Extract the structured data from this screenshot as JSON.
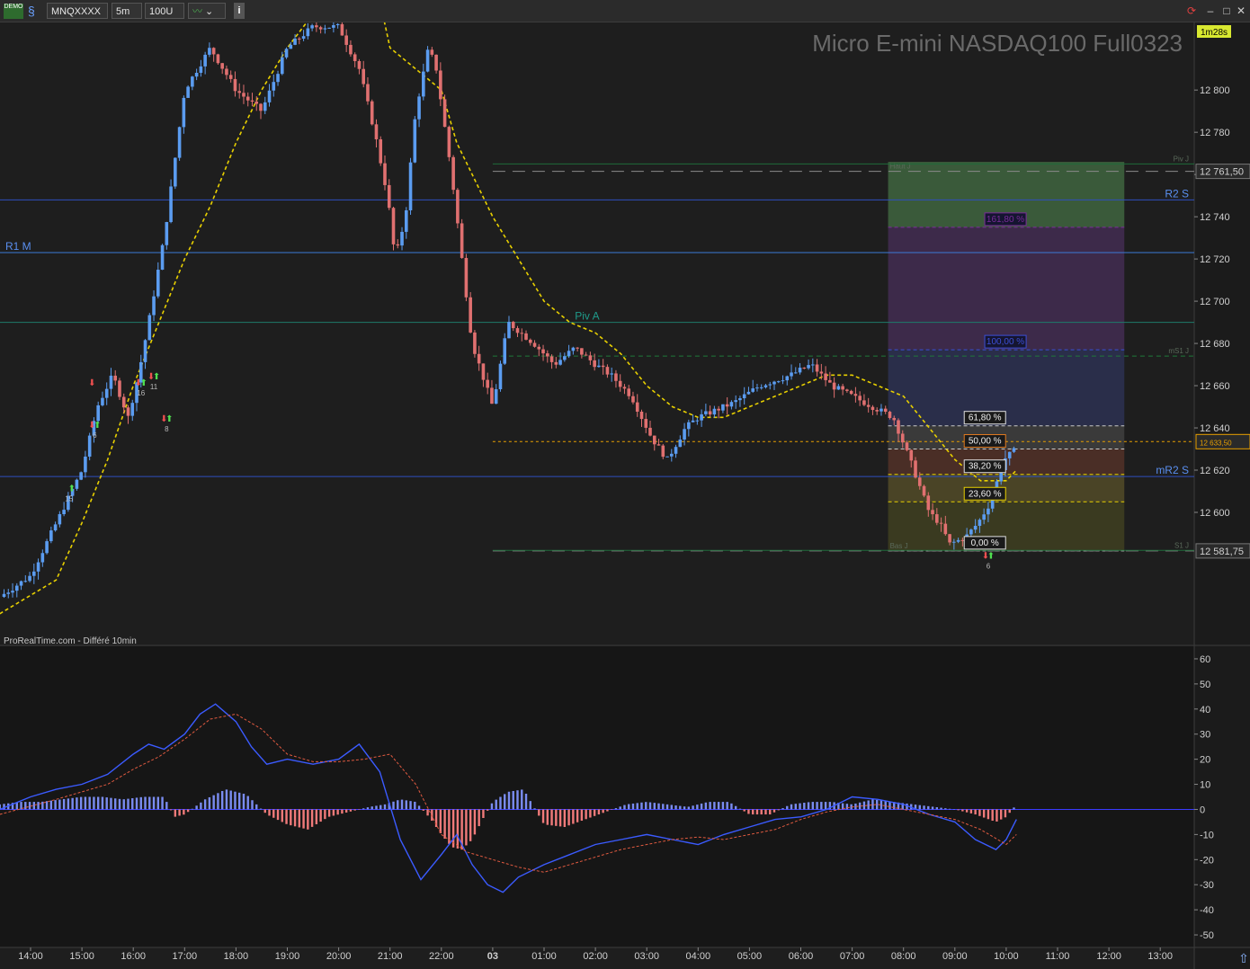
{
  "toolbar": {
    "demo_label": "DEMO",
    "instrument": "MNQXXXX",
    "timeframe": "5m",
    "units": "100U",
    "info_icon": "info-icon",
    "chevron_icon": "chevron-down-icon"
  },
  "chart_data": [
    {
      "type": "candlestick",
      "title": "Micro E-mini NASDAQ100 Full0323",
      "footer": "ProRealTime.com - Différé 10min",
      "timer": "1m28s",
      "ylim": [
        12537,
        12832
      ],
      "y_ticks": [
        12600,
        12620,
        12640,
        12660,
        12680,
        12700,
        12720,
        12740,
        12760,
        12780,
        12800
      ],
      "y_tick_labels": [
        "12 600",
        "12 620",
        "12 640",
        "12 660",
        "12 680",
        "12 700",
        "12 720",
        "12 740",
        "12 760",
        "12 780",
        "12 800"
      ],
      "x_ticks": [
        "14:00",
        "15:00",
        "16:00",
        "17:00",
        "18:00",
        "19:00",
        "20:00",
        "21:00",
        "22:00",
        "03",
        "01:00",
        "02:00",
        "03:00",
        "04:00",
        "05:00",
        "06:00",
        "07:00",
        "08:00",
        "09:00",
        "10:00",
        "11:00",
        "12:00",
        "13:00"
      ],
      "x_tick_hours": [
        0,
        1,
        2,
        3,
        4,
        5,
        6,
        7,
        8,
        9,
        10,
        11,
        12,
        13,
        14,
        15,
        16,
        17,
        18,
        19,
        20,
        21,
        22
      ],
      "price_path_hours": [
        -0.6,
        0.0,
        0.5,
        1.0,
        1.3,
        1.6,
        1.9,
        2.1,
        2.3,
        2.6,
        3.0,
        3.5,
        4.0,
        4.5,
        5.0,
        5.5,
        6.0,
        6.4,
        6.7,
        6.95,
        7.1,
        7.3,
        7.5,
        7.75,
        7.9,
        8.2,
        8.4,
        8.6,
        9.0,
        9.3,
        9.8,
        10.2,
        10.6,
        11.0,
        11.3,
        11.7,
        12.1,
        12.4,
        12.75,
        13.0,
        13.3,
        13.7,
        14.2,
        14.8,
        15.2,
        15.6,
        16.0,
        16.4,
        16.8,
        17.2,
        17.5,
        17.7,
        17.9,
        18.2,
        18.45,
        18.7,
        18.95,
        19.2
      ],
      "price_path_values": [
        12560,
        12570,
        12595,
        12620,
        12650,
        12665,
        12645,
        12665,
        12690,
        12730,
        12800,
        12820,
        12800,
        12790,
        12820,
        12830,
        12830,
        12810,
        12780,
        12750,
        12720,
        12740,
        12790,
        12820,
        12810,
        12760,
        12720,
        12680,
        12650,
        12690,
        12680,
        12670,
        12678,
        12670,
        12665,
        12655,
        12635,
        12625,
        12640,
        12645,
        12648,
        12652,
        12660,
        12665,
        12670,
        12660,
        12655,
        12650,
        12645,
        12620,
        12600,
        12595,
        12585,
        12588,
        12595,
        12605,
        12625,
        12630
      ],
      "moving_average_hours": [
        -0.6,
        0.5,
        1.0,
        1.5,
        2.0,
        2.5,
        3.0,
        3.5,
        4.0,
        4.5,
        5.0,
        5.5,
        6.0,
        6.3,
        6.6,
        7.0,
        7.5,
        8.0,
        8.3,
        8.6,
        9.0,
        9.5,
        10.0,
        10.5,
        11.0,
        11.5,
        12.0,
        12.5,
        13.0,
        13.5,
        14.0,
        14.5,
        15.0,
        15.5,
        16.0,
        16.5,
        17.0,
        17.5,
        18.0,
        18.5,
        19.0,
        19.2
      ],
      "moving_average_values": [
        12552,
        12568,
        12595,
        12625,
        12660,
        12690,
        12720,
        12745,
        12775,
        12800,
        12820,
        12836,
        12850,
        12860,
        12865,
        12820,
        12810,
        12800,
        12775,
        12760,
        12740,
        12720,
        12700,
        12690,
        12685,
        12675,
        12660,
        12650,
        12645,
        12645,
        12650,
        12655,
        12660,
        12665,
        12665,
        12660,
        12655,
        12640,
        12625,
        12615,
        12615,
        12620
      ],
      "horizontal_levels": [
        {
          "label": "Haut J",
          "value": 12761.5,
          "color": "#8a8a8a",
          "style": "long-dash",
          "start_hour": 9
        },
        {
          "label": "Piv J",
          "value": 12765,
          "color": "#1f6b3a",
          "style": "solid",
          "start_hour": 9
        },
        {
          "label": "R2 S",
          "value": 12748,
          "color": "#2f4fbf",
          "style": "solid"
        },
        {
          "label": "R1 M",
          "value": 12723,
          "color": "#3b7bd6",
          "style": "solid"
        },
        {
          "label": "Piv A",
          "value": 12690,
          "color": "#1f7a6a",
          "style": "solid"
        },
        {
          "label": "mS1 J",
          "value": 12674,
          "color": "#1f7a3a",
          "style": "dash",
          "start_hour": 9
        },
        {
          "label": "",
          "value": 12633.5,
          "color": "#e8a000",
          "style": "short-dash",
          "start_hour": 9
        },
        {
          "label": "mR2 S",
          "value": 12617,
          "color": "#2f4fbf",
          "style": "solid"
        },
        {
          "label": "Bas J",
          "value": 12581.75,
          "color": "#8a8a8a",
          "style": "long-dash",
          "start_hour": 9
        },
        {
          "label": "S1 J",
          "value": 12582,
          "color": "#1f6b3a",
          "style": "solid",
          "start_hour": 9
        }
      ],
      "price_badges": [
        {
          "label": "12 761,50",
          "value": 12761.5,
          "bg": "#2a2a2a",
          "fg": "#d0d0d0",
          "border": "#777"
        },
        {
          "label": "12 633,50",
          "value": 12633.5,
          "bg": "#2a2a2a",
          "fg": "#e8a000",
          "border": "#e8a000",
          "small": true
        },
        {
          "label": "12 581,75",
          "value": 12581.75,
          "bg": "#2a2a2a",
          "fg": "#d0d0d0",
          "border": "#777"
        }
      ],
      "fibonacci": {
        "start_hour": 16.7,
        "end_hour": 21.3,
        "zones": [
          {
            "from": 12766,
            "to": 12735,
            "color": "#3a5a3a"
          },
          {
            "from": 12735,
            "to": 12677,
            "color": "#3d2a4a"
          },
          {
            "from": 12677,
            "to": 12641,
            "color": "#2a2e4a"
          },
          {
            "from": 12641,
            "to": 12630,
            "color": "#3a3a3a"
          },
          {
            "from": 12630,
            "to": 12618,
            "color": "#4a2e26"
          },
          {
            "from": 12618,
            "to": 12605,
            "color": "#4a4426"
          },
          {
            "from": 12605,
            "to": 12581.75,
            "color": "#3a3a20"
          }
        ],
        "levels": [
          {
            "label": "161,80 %",
            "value": 12735,
            "box_color": "#7a2a9a",
            "line_color": "#7a2a9a",
            "label_hour": 18.6
          },
          {
            "label": "100,00 %",
            "value": 12677,
            "box_color": "#3b4fd6",
            "line_color": "#3b4fd6",
            "label_hour": 18.6
          },
          {
            "label": "61,80 %",
            "value": 12641,
            "box_color": "#e0e0e0",
            "line_color": "#c8c8c8",
            "label_hour": 18.2
          },
          {
            "label": "50,00 %",
            "value": 12630,
            "box_color": "#e07a20",
            "line_color": "#c8c8c8",
            "label_hour": 18.2
          },
          {
            "label": "38,20 %",
            "value": 12618,
            "box_color": "#e0e0e0",
            "line_color": "#e8d000",
            "label_hour": 18.2
          },
          {
            "label": "23,60 %",
            "value": 12605,
            "box_color": "#e8d000",
            "line_color": "#e8d000",
            "label_hour": 18.2
          },
          {
            "label": "0,00 %",
            "value": 12581.75,
            "box_color": "#e0e0e0",
            "line_color": "#c8c8c8",
            "label_hour": 18.2
          }
        ]
      },
      "signal_arrows": [
        {
          "hour": 0.75,
          "value": 12610,
          "dir": "up",
          "count": "15"
        },
        {
          "hour": 1.25,
          "value": 12660,
          "dir": "down",
          "count": ""
        },
        {
          "hour": 1.25,
          "value": 12640,
          "dir": "both",
          "count": "6"
        },
        {
          "hour": 2.15,
          "value": 12660,
          "dir": "both",
          "count": "16"
        },
        {
          "hour": 2.4,
          "value": 12663,
          "dir": "both",
          "count": "11"
        },
        {
          "hour": 2.65,
          "value": 12643,
          "dir": "both",
          "count": "8"
        },
        {
          "hour": 18.65,
          "value": 12578,
          "dir": "both",
          "count": "6"
        }
      ],
      "colors": {
        "up_candle": "#5b9cf0",
        "down_candle": "#e07070",
        "moving_average": "#e8d000",
        "background": "#1e1e1e",
        "title": "#6a6a6a"
      }
    },
    {
      "type": "macd",
      "ylim": [
        -55,
        65
      ],
      "y_ticks": [
        60,
        50,
        40,
        30,
        20,
        10,
        0,
        -10,
        -20,
        -30,
        -40,
        -50
      ],
      "y_tick_labels": [
        "60",
        "50",
        "40",
        "30",
        "20",
        "10",
        "0",
        "-10",
        "-20",
        "-30",
        "-40",
        "-50"
      ],
      "macd_hours": [
        -0.6,
        0.0,
        0.5,
        1.0,
        1.5,
        2.0,
        2.3,
        2.6,
        3.0,
        3.3,
        3.6,
        4.0,
        4.3,
        4.6,
        5.0,
        5.5,
        6.0,
        6.4,
        6.8,
        7.2,
        7.6,
        8.0,
        8.3,
        8.6,
        8.9,
        9.2,
        9.5,
        10.0,
        10.5,
        11.0,
        11.5,
        12.0,
        12.5,
        13.0,
        13.5,
        14.0,
        14.5,
        15.0,
        15.5,
        16.0,
        16.5,
        17.0,
        17.5,
        18.0,
        18.4,
        18.8,
        19.0,
        19.2
      ],
      "macd_values": [
        0,
        5,
        8,
        10,
        14,
        22,
        26,
        24,
        30,
        38,
        42,
        35,
        25,
        18,
        20,
        18,
        20,
        26,
        15,
        -12,
        -28,
        -18,
        -10,
        -22,
        -30,
        -33,
        -27,
        -22,
        -18,
        -14,
        -12,
        -10,
        -12,
        -14,
        -10,
        -7,
        -4,
        -3,
        0,
        5,
        4,
        2,
        -2,
        -5,
        -12,
        -16,
        -12,
        -4
      ],
      "signal_hours": [
        -0.6,
        0.5,
        1.0,
        1.5,
        2.0,
        2.5,
        3.0,
        3.5,
        4.0,
        4.5,
        5.0,
        5.5,
        6.0,
        6.5,
        7.0,
        7.5,
        8.0,
        8.5,
        9.0,
        9.5,
        10.0,
        10.5,
        11.0,
        11.5,
        12.0,
        12.5,
        13.0,
        13.5,
        14.0,
        14.5,
        15.0,
        15.5,
        16.0,
        16.5,
        17.0,
        17.5,
        18.0,
        18.5,
        19.0,
        19.2
      ],
      "signal_values": [
        -2,
        4,
        7,
        10,
        16,
        21,
        28,
        36,
        38,
        32,
        22,
        19,
        19,
        20,
        22,
        10,
        -10,
        -17,
        -20,
        -23,
        -25,
        -22,
        -19,
        -16,
        -14,
        -12,
        -11,
        -12,
        -10,
        -8,
        -4,
        -1,
        1,
        2,
        0,
        -2,
        -4,
        -8,
        -14,
        -10
      ],
      "histogram_hours": [
        -0.6,
        -0.2,
        0.2,
        0.6,
        1.0,
        1.4,
        1.8,
        2.2,
        2.6,
        2.8,
        3.0,
        3.4,
        3.8,
        4.2,
        4.6,
        5.0,
        5.4,
        5.8,
        6.2,
        6.6,
        6.9,
        7.2,
        7.5,
        7.8,
        8.0,
        8.2,
        8.4,
        8.6,
        8.8,
        9.0,
        9.3,
        9.6,
        10.0,
        10.4,
        10.8,
        11.2,
        11.6,
        12.0,
        12.4,
        12.8,
        13.2,
        13.6,
        14.0,
        14.4,
        14.8,
        15.2,
        15.6,
        16.0,
        16.4,
        16.8,
        17.2,
        17.6,
        18.0,
        18.4,
        18.8,
        19.0,
        19.2
      ],
      "histogram_values": [
        2,
        3,
        3,
        4,
        5,
        5,
        4,
        5,
        5,
        -3,
        -2,
        4,
        8,
        6,
        -2,
        -6,
        -8,
        -3,
        -1,
        1,
        2,
        4,
        3,
        -4,
        -10,
        -15,
        -16,
        -12,
        -4,
        3,
        7,
        8,
        -6,
        -7,
        -4,
        -1,
        2,
        3,
        2,
        1,
        3,
        3,
        -2,
        -2,
        2,
        3,
        3,
        2,
        4,
        3,
        2,
        1,
        0,
        -2,
        -5,
        -3,
        2,
        5
      ],
      "colors": {
        "macd_line": "#3b5bff",
        "signal_line": "#e05a40",
        "hist_pos": "#7a8cf0",
        "hist_neg": "#f07a7a",
        "zero_line": "#3b3bff"
      }
    }
  ]
}
